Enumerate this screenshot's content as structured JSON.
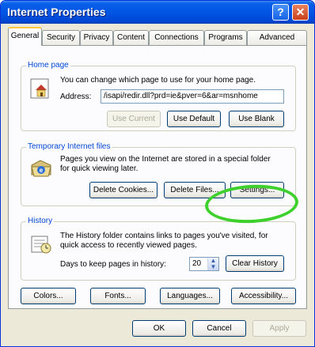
{
  "window": {
    "title": "Internet Properties",
    "help_label": "?",
    "close_label": "✕"
  },
  "tabs": [
    {
      "label": "General",
      "active": true
    },
    {
      "label": "Security"
    },
    {
      "label": "Privacy"
    },
    {
      "label": "Content"
    },
    {
      "label": "Connections"
    },
    {
      "label": "Programs"
    },
    {
      "label": "Advanced"
    }
  ],
  "home_page": {
    "group_label": "Home page",
    "description": "You can change which page to use for your home page.",
    "address_label": "Address:",
    "address_value": "/isapi/redir.dll?prd=ie&pver=6&ar=msnhome",
    "use_current": "Use Current",
    "use_default": "Use Default",
    "use_blank": "Use Blank"
  },
  "temp_files": {
    "group_label": "Temporary Internet files",
    "description_line1": "Pages you view on the Internet are stored in a special folder",
    "description_line2": "for quick viewing later.",
    "delete_cookies": "Delete Cookies...",
    "delete_files": "Delete Files...",
    "settings": "Settings..."
  },
  "history": {
    "group_label": "History",
    "description_line1": "The History folder contains links to pages you've visited, for",
    "description_line2": "quick access to recently viewed pages.",
    "days_label": "Days to keep pages in history:",
    "days_value": "20",
    "clear_history": "Clear History"
  },
  "bottom_buttons": {
    "colors": "Colors...",
    "fonts": "Fonts...",
    "languages": "Languages...",
    "accessibility": "Accessibility..."
  },
  "dialog_buttons": {
    "ok": "OK",
    "cancel": "Cancel",
    "apply": "Apply"
  },
  "colors": {
    "title_blue": "#0055e5",
    "group_label_blue": "#0046d5",
    "highlight_green": "#3ed02c",
    "dialog_bg": "#ece9d8"
  },
  "icons": {
    "home": "home-page-icon",
    "temp_files": "temp-files-icon",
    "history": "history-icon"
  }
}
